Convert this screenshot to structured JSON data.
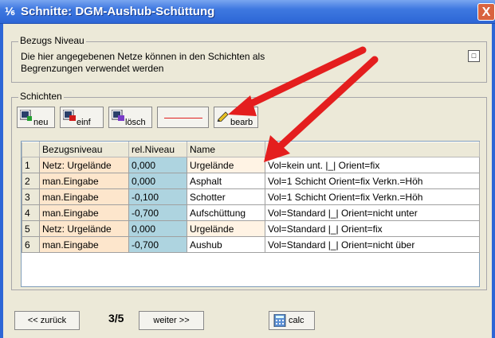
{
  "window": {
    "title": "Schnitte: DGM-Aushub-Schüttung",
    "close": "X",
    "icon": "⅟⁄₆"
  },
  "bezugs": {
    "legend": "Bezugs Niveau",
    "desc": "Die hier angegebenen Netze können  in den Schichten als Begrenzungen verwendet werden",
    "expand": "□"
  },
  "schichten": {
    "legend": "Schichten",
    "buttons": {
      "neu": "neu",
      "einf": "einf",
      "losch": "lösch",
      "bearb": "bearb"
    },
    "columns": [
      "Bezugsniveau",
      "rel.Niveau",
      "Name",
      "Info"
    ],
    "rows": [
      {
        "n": "1",
        "bezug": "Netz: Urgelände",
        "rel": "0,000",
        "name": "Urgelände",
        "info": "Vol=kein unt. |_| Orient=fix"
      },
      {
        "n": "2",
        "bezug": "man.Eingabe",
        "rel": "0,000",
        "name": "Asphalt",
        "info": "Vol=1 Schicht Orient=fix Verkn.=Höh"
      },
      {
        "n": "3",
        "bezug": "man.Eingabe",
        "rel": "-0,100",
        "name": "Schotter",
        "info": "Vol=1 Schicht Orient=fix Verkn.=Höh"
      },
      {
        "n": "4",
        "bezug": "man.Eingabe",
        "rel": "-0,700",
        "name": "Aufschüttung",
        "info": "Vol=Standard  |_| Orient=nicht unter"
      },
      {
        "n": "5",
        "bezug": "Netz: Urgelände",
        "rel": "0,000",
        "name": "Urgelände",
        "info": "Vol=Standard  |_| Orient=fix"
      },
      {
        "n": "6",
        "bezug": "man.Eingabe",
        "rel": "-0,700",
        "name": "Aushub",
        "info": "Vol=Standard  |_| Orient=nicht über"
      }
    ]
  },
  "nav": {
    "back": "<< zurück",
    "page": "3/5",
    "next": "weiter >>",
    "calc": "calc"
  },
  "colors": {
    "title_bar": "#2d66d6",
    "arrow": "#e41e1e",
    "bezug_cell": "#fde6cc",
    "rel_cell": "#aed4e0"
  }
}
